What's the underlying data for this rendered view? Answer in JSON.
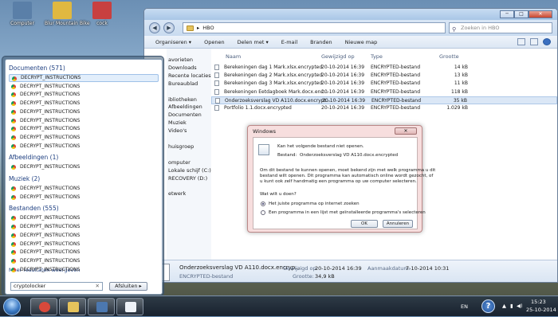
{
  "desktop": {
    "icons": [
      {
        "label": "Computer",
        "color": "#5a7fa8"
      },
      {
        "label": "Blur Mountain Bike",
        "color": "#e0b840"
      },
      {
        "label": "cock",
        "color": "#c84040"
      }
    ]
  },
  "explorer": {
    "breadcrumb_sep": "▸",
    "path": "HBO",
    "search_placeholder": "Zoeken in HBO",
    "window_buttons": [
      "─",
      "□",
      "✕"
    ],
    "toolbar": {
      "organize": "Organiseren ▾",
      "open": "Openen",
      "share": "Delen met ▾",
      "email": "E-mail",
      "burn": "Branden",
      "new_folder": "Nieuwe map"
    },
    "nav": [
      "avorieten",
      "Downloads",
      "Recente locaties",
      "Bureaublad",
      "",
      "ibliotheken",
      "Afbeeldingen",
      "Documenten",
      "Muziek",
      "Video's",
      "",
      "huisgroep",
      "",
      "omputer",
      "Lokale schijf (C:)",
      "RECOVERY (D:)",
      "",
      "etwerk"
    ],
    "columns": {
      "name": "Naam",
      "modified": "Gewijzigd op",
      "type": "Type",
      "size": "Grootte"
    },
    "files": [
      {
        "name": "Berekeningen dag 1 Mark.xlsx.encrypted",
        "date": "20-10-2014 16:39",
        "type": "ENCRYPTED-bestand",
        "size": "14 kB"
      },
      {
        "name": "Berekeningen dag 2 Mark.xlsx.encrypted",
        "date": "20-10-2014 16:39",
        "type": "ENCRYPTED-bestand",
        "size": "13 kB"
      },
      {
        "name": "Berekeningen dag 3 Mark.xlsx.encrypted",
        "date": "20-10-2014 16:39",
        "type": "ENCRYPTED-bestand",
        "size": "11 kB"
      },
      {
        "name": "Berekeningen Eetdagboek Mark.docx.enc...",
        "date": "20-10-2014 16:39",
        "type": "ENCRYPTED-bestand",
        "size": "118 kB"
      },
      {
        "name": "Onderzoeksverslag VD A110.docx.encrypt...",
        "date": "20-10-2014 16:39",
        "type": "ENCRYPTED-bestand",
        "size": "35 kB"
      },
      {
        "name": "Portfolio 1.1.docx.encrypted",
        "date": "20-10-2014 16:39",
        "type": "ENCRYPTED-bestand",
        "size": "1.029 kB"
      }
    ],
    "details": {
      "filename": "Onderzoeksverslag VD A110.docx.encryp...",
      "modified_label": "Gewijzigd op:",
      "modified": "20-10-2014 16:39",
      "created_label": "Aanmaakdatum:",
      "created": "7-10-2014 10:31",
      "type": "ENCRYPTED-bestand",
      "size_label": "Grootte:",
      "size": "34,9 kB"
    }
  },
  "dialog": {
    "title": "Windows",
    "close": "✕",
    "msg": "Kan het volgende bestand niet openen.",
    "file_label": "Bestand:",
    "file": "Onderzoeksverslag VD A110.docx.encrypted",
    "explain": [
      "Om dit bestand te kunnen openen, moet bekend zijn met welk programma u dit",
      "bestand wilt openen. Dit programma kan automatisch online wordt gezocht, of",
      "u kunt ook zelf handmatig een programma op uw computer selecteren."
    ],
    "question": "Wat wilt u doen?",
    "opt1": "Het juiste programma op internet zoeken",
    "opt2": "Een programma in een lijst met geïnstalleerde programma's selecteren",
    "ok": "OK",
    "cancel": "Annuleren"
  },
  "start": {
    "groups": [
      {
        "title": "Documenten (571)",
        "items": [
          "DECRYPT_INSTRUCTIONS",
          "DECRYPT_INSTRUCTIONS",
          "DECRYPT_INSTRUCTIONS",
          "DECRYPT_INSTRUCTIONS",
          "DECRYPT_INSTRUCTIONS",
          "DECRYPT_INSTRUCTIONS",
          "DECRYPT_INSTRUCTIONS",
          "DECRYPT_INSTRUCTIONS",
          "DECRYPT_INSTRUCTIONS"
        ]
      },
      {
        "title": "Afbeeldingen (1)",
        "items": [
          "DECRYPT_INSTRUCTIONS"
        ]
      },
      {
        "title": "Muziek (2)",
        "items": [
          "DECRYPT_INSTRUCTIONS",
          "DECRYPT_INSTRUCTIONS"
        ]
      },
      {
        "title": "Bestanden (555)",
        "items": [
          "DECRYPT_INSTRUCTIONS",
          "DECRYPT_INSTRUCTIONS",
          "DECRYPT_INSTRUCTIONS",
          "DECRYPT_INSTRUCTIONS",
          "DECRYPT_INSTRUCTIONS",
          "DECRYPT_INSTRUCTIONS",
          "DECRYPT_INSTRUCTIONS"
        ]
      }
    ],
    "more": "Meer resultaten weergeven",
    "search_value": "cryptolocker",
    "search_clear": "✕",
    "shutdown": "Afsluiten",
    "shutdown_arrow": "▸"
  },
  "taskbar": {
    "apps": [
      {
        "name": "chrome",
        "color": "#d9493b"
      },
      {
        "name": "explorer",
        "color": "#e6c35c"
      },
      {
        "name": "media",
        "color": "#4c78b0"
      },
      {
        "name": "document",
        "color": "#eef2f7"
      }
    ],
    "lang": "EN",
    "time": "15:23",
    "date": "25-10-2014",
    "help": "?"
  }
}
